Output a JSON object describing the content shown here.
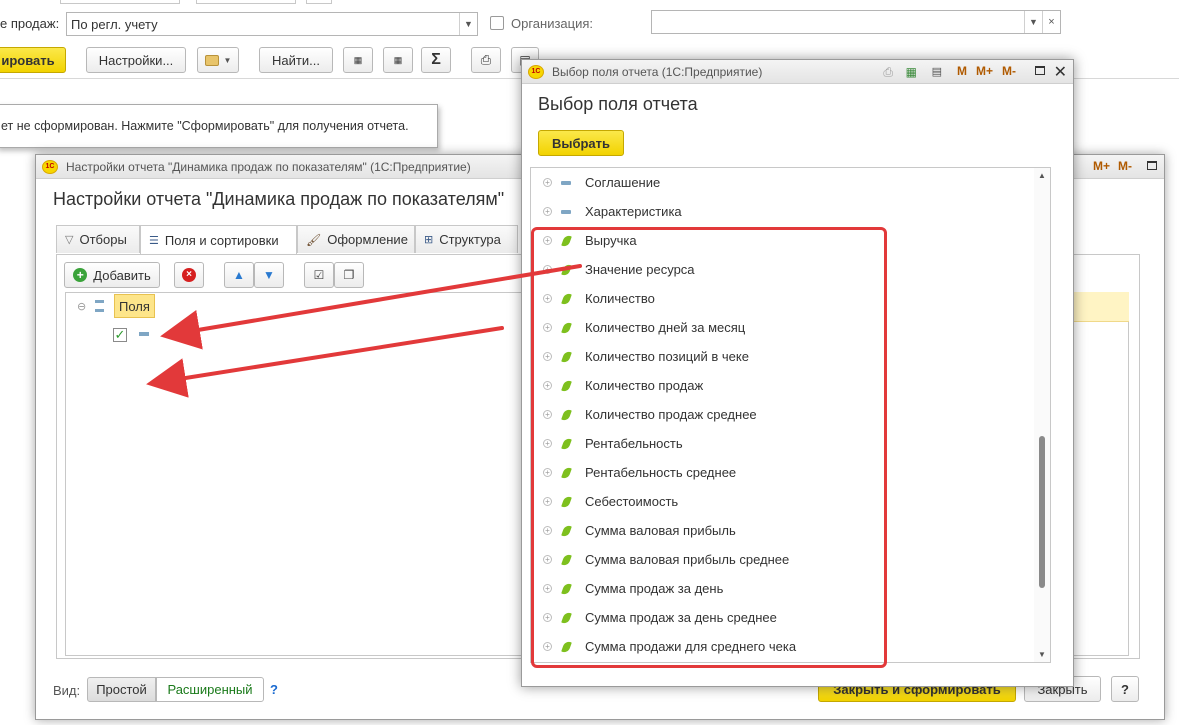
{
  "background_form": {
    "sales_label": "е продаж:",
    "sales_value": "По регл. учету",
    "org_label": "Организация:",
    "org_value": "",
    "generate_button": "ировать",
    "settings_button": "Настройки...",
    "find_button": "Найти...",
    "sum_icon": "Σ",
    "message": "ет не сформирован. Нажмите \"Сформировать\" для получения отчета."
  },
  "settings_window": {
    "title_bar": "Настройки отчета \"Динамика продаж по показателям\"  (1С:Предприятие)",
    "heading": "Настройки отчета \"Динамика продаж по показателям\"",
    "tabs": [
      {
        "label": "Отборы",
        "icon": "filter-icon"
      },
      {
        "label": "Поля и сортировки",
        "icon": "fields-icon"
      },
      {
        "label": "Оформление",
        "icon": "brush-icon"
      },
      {
        "label": "Структура",
        "icon": "structure-icon"
      }
    ],
    "add_button": "Добавить",
    "tree_root": "Поля",
    "view_label": "Вид:",
    "view_simple": "Простой",
    "view_extended": "Расширенный",
    "help": "?",
    "close_generate_button": "Закрыть и сформировать",
    "close_button": "Закрыть",
    "help_button": "?",
    "title_buttons": [
      "M+",
      "M-"
    ]
  },
  "select_window": {
    "title_bar": "Выбор поля отчета  (1С:Предприятие)",
    "heading": "Выбор поля отчета",
    "select_button": "Выбрать",
    "title_buttons": [
      "M",
      "M+",
      "M-"
    ],
    "items": [
      {
        "label": "Соглашение",
        "icon": "dimension-icon"
      },
      {
        "label": "Характеристика",
        "icon": "dimension-icon"
      },
      {
        "label": "Выручка",
        "icon": "resource-icon"
      },
      {
        "label": "Значение ресурса",
        "icon": "resource-icon"
      },
      {
        "label": "Количество",
        "icon": "resource-icon"
      },
      {
        "label": "Количество дней за месяц",
        "icon": "resource-icon"
      },
      {
        "label": "Количество позиций в чеке",
        "icon": "resource-icon"
      },
      {
        "label": "Количество продаж",
        "icon": "resource-icon"
      },
      {
        "label": "Количество продаж среднее",
        "icon": "resource-icon"
      },
      {
        "label": "Рентабельность",
        "icon": "resource-icon"
      },
      {
        "label": "Рентабельность среднее",
        "icon": "resource-icon"
      },
      {
        "label": "Себестоимость",
        "icon": "resource-icon"
      },
      {
        "label": "Сумма валовая прибыль",
        "icon": "resource-icon"
      },
      {
        "label": "Сумма валовая прибыль среднее",
        "icon": "resource-icon"
      },
      {
        "label": "Сумма продаж за день",
        "icon": "resource-icon"
      },
      {
        "label": "Сумма продаж за день среднее",
        "icon": "resource-icon"
      },
      {
        "label": "Сумма продажи для среднего чека",
        "icon": "resource-icon"
      }
    ]
  },
  "colors": {
    "highlight_border": "#e2393a",
    "arrow": "#e2393a",
    "accent_yellow": "#f5d90f",
    "resource_leaf": "#7ec01e",
    "link_green": "#1a7a1a"
  }
}
